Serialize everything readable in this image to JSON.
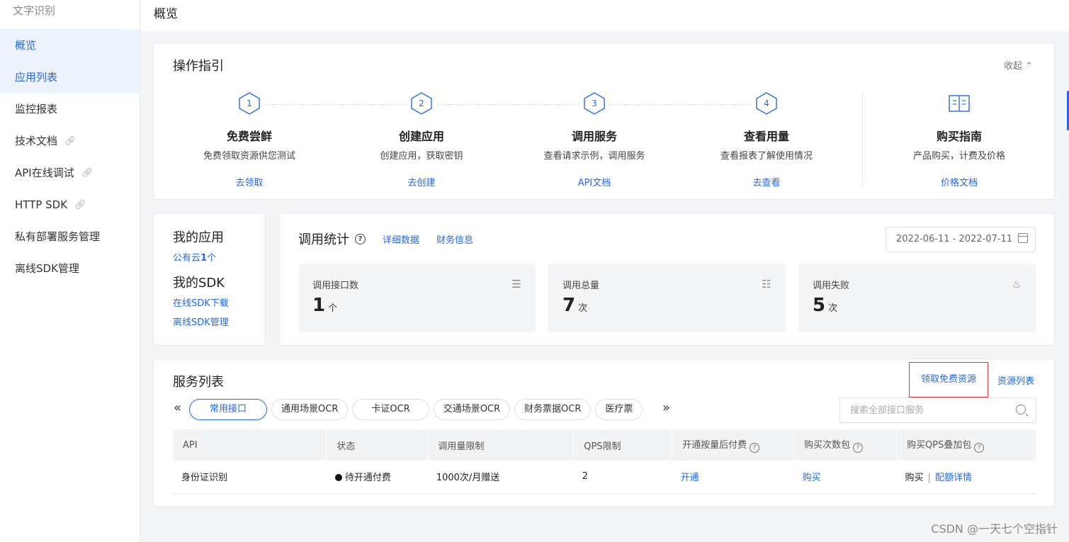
{
  "sidebar": {
    "product": "文字识别",
    "items": [
      {
        "label": "概览",
        "active": true,
        "external": false
      },
      {
        "label": "应用列表",
        "active": true,
        "external": false
      },
      {
        "label": "监控报表",
        "active": false,
        "external": false
      },
      {
        "label": "技术文档",
        "active": false,
        "external": true
      },
      {
        "label": "API在线调试",
        "active": false,
        "external": true
      },
      {
        "label": "HTTP SDK",
        "active": false,
        "external": true
      },
      {
        "label": "私有部署服务管理",
        "active": false,
        "external": false
      },
      {
        "label": "离线SDK管理",
        "active": false,
        "external": false
      }
    ]
  },
  "header": {
    "title": "概览"
  },
  "guide": {
    "title": "操作指引",
    "collapse_label": "收起",
    "steps": [
      {
        "num": "1",
        "title": "免费尝鲜",
        "desc": "免费领取资源供您测试",
        "link": "去领取"
      },
      {
        "num": "2",
        "title": "创建应用",
        "desc": "创建应用，获取密钥",
        "link": "去创建"
      },
      {
        "num": "3",
        "title": "调用服务",
        "desc": "查看请求示例，调用服务",
        "link": "API文档"
      },
      {
        "num": "4",
        "title": "查看用量",
        "desc": "查看报表了解使用情况",
        "link": "去查看"
      }
    ],
    "purchase": {
      "title": "购买指南",
      "desc": "产品购买，计费及价格",
      "link": "价格文档"
    }
  },
  "my_app": {
    "title": "我的应用",
    "public_cloud_prefix": "公有云",
    "public_cloud_count": "1",
    "public_cloud_suffix": "个",
    "sdk_title": "我的SDK",
    "sdk_download": "在线SDK下载",
    "sdk_manage": "离线SDK管理"
  },
  "stats": {
    "title": "调用统计",
    "detail_link": "详细数据",
    "finance_link": "财务信息",
    "date_range": "2022-06-11 - 2022-07-11",
    "metrics": [
      {
        "label": "调用接口数",
        "value": "1",
        "unit": "个",
        "icon": "interface-icon"
      },
      {
        "label": "调用总量",
        "value": "7",
        "unit": "次",
        "icon": "grid-icon"
      },
      {
        "label": "调用失败",
        "value": "5",
        "unit": "次",
        "icon": "failure-icon"
      }
    ]
  },
  "services": {
    "title": "服务列表",
    "free_resource": "领取免费资源",
    "resource_list": "资源列表",
    "tabs": [
      "常用接口",
      "通用场景OCR",
      "卡证OCR",
      "交通场景OCR",
      "财务票据OCR",
      "医疗票"
    ],
    "search_placeholder": "搜索全部接口服务",
    "columns": [
      "API",
      "状态",
      "调用量限制",
      "QPS限制",
      "开通按量后付费",
      "购买次数包",
      "购买QPS叠加包"
    ],
    "rows": [
      {
        "api": "身份证识别",
        "status": "待开通付费",
        "limit": "1000次/月赠送",
        "qps": "2",
        "postpaid": "开通",
        "pack": "购买",
        "qps_buy": "购买",
        "qps_detail": "配额详情"
      }
    ]
  },
  "watermark": "CSDN @一天七个空指针",
  "colors": {
    "accent": "#2468f2",
    "highlight_border": "#e23a3a",
    "active_bg": "#eef4fd"
  }
}
